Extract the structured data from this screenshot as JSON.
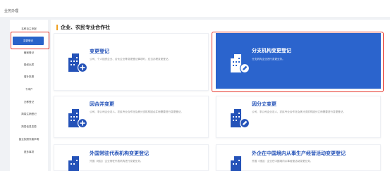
{
  "header": {
    "title": "业务办理"
  },
  "sidebar": {
    "items": [
      {
        "label": "名称自主申报"
      },
      {
        "label": "变更登记"
      },
      {
        "label": "备案登记"
      },
      {
        "label": "股权出质"
      },
      {
        "label": "增补执照"
      },
      {
        "label": "个体户"
      },
      {
        "label": "迁移登记"
      },
      {
        "label": "简易注销登记"
      },
      {
        "label": "简易信息变更"
      },
      {
        "label": "营业执照作废声明"
      },
      {
        "label": "更多事项"
      }
    ]
  },
  "main": {
    "section_title": "企业、农民专业合作社",
    "cards": [
      {
        "title": "变更登记",
        "desc": "公司、个人独资企业、合伙企业等变更登记事项时，应当办理变更登记。"
      },
      {
        "title": "分支机构变更登记",
        "desc": "分支机构企业进行变更业务。"
      },
      {
        "title": "因合并变更",
        "desc": "公司、非公司企业法人、农民专业合作社及其分支机构因合并而需要进行变更登记。"
      },
      {
        "title": "因分立变更",
        "desc": "公司、非公司企业法人、农民专业合作社及其分支机构因分立而需要进行变更登记。"
      },
      {
        "title": "外国常驻代表机构变更登记",
        "desc": "外国（地区）企业常驻代表机构进行变更业务。"
      },
      {
        "title": "外企在中国境内从事生产经营活动变更登记",
        "desc": "外国（地区）企业在中国境内从事经营活动变更业务。"
      }
    ]
  }
}
